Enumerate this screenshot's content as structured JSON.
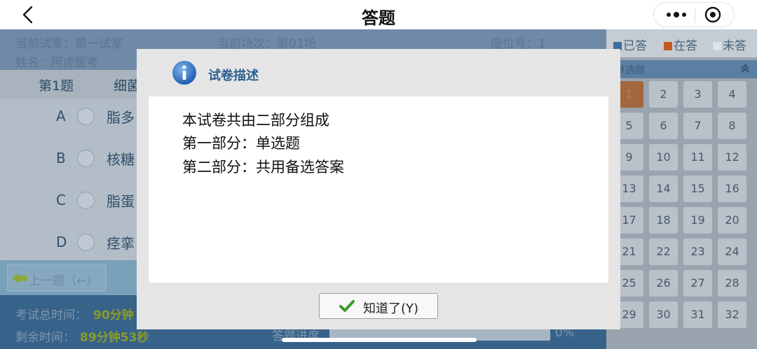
{
  "navbar": {
    "title": "答题"
  },
  "exam_info": {
    "room": "当前试室：第一试室",
    "session": "当前场次：第01场",
    "seat": "座位号：1",
    "name": "姓名：阿虎医考"
  },
  "question": {
    "number": "第1题",
    "subject_partial": "细菌",
    "options": [
      {
        "letter": "A",
        "text": "脂多"
      },
      {
        "letter": "B",
        "text": "核糖"
      },
      {
        "letter": "C",
        "text": "脂蛋"
      },
      {
        "letter": "D",
        "text": "痉挛"
      }
    ]
  },
  "prev_button": {
    "label": "上一题（←）"
  },
  "timer": {
    "total_label": "考试总时间：",
    "total_value": "90分钟",
    "remain_label": "剩余时间：",
    "remain_value": "89分钟53秒",
    "progress_label": "答题进度",
    "progress_value": "0%",
    "progress_fraction": 0
  },
  "sidebar": {
    "legend": [
      {
        "label": "已答",
        "color": "#3e6d9a"
      },
      {
        "label": "在答",
        "color": "#c45a22"
      },
      {
        "label": "未答",
        "color": "#dfe3e7"
      }
    ],
    "section_title": "单选题",
    "numbers": [
      "1",
      "2",
      "3",
      "4",
      "5",
      "6",
      "7",
      "8",
      "9",
      "10",
      "11",
      "12",
      "13",
      "14",
      "15",
      "16",
      "17",
      "18",
      "19",
      "20",
      "21",
      "22",
      "23",
      "24",
      "25",
      "26",
      "27",
      "28",
      "29",
      "30",
      "31",
      "32"
    ],
    "current": "1"
  },
  "modal": {
    "title": "试卷描述",
    "lines": [
      "本试卷共由二部分组成",
      "第一部分：单选题",
      "第二部分：共用备选答案"
    ],
    "ok_label": "知道了(Y)"
  }
}
